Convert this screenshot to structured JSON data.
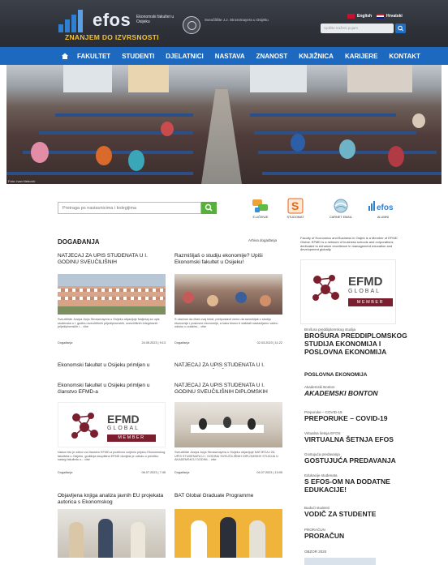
{
  "header": {
    "logo_word": "efos",
    "logo_sub": "Ekonomski fakultet u Osijeku",
    "logo_tagline": "ZNANJEM DO IZVRSNOSTI",
    "university": "Sveučilište J.J. Strossmayera u Osijeku",
    "lang_en": "English",
    "lang_hr": "Hrvatski",
    "search_placeholder": "Upišite traženi pojam",
    "brand_color": "#1d69bf"
  },
  "nav": [
    "FAKULTET",
    "STUDENTI",
    "DJELATNICI",
    "NASTAVA",
    "ZNANOST",
    "KNJIŽNICA",
    "KARIJERE",
    "KONTAKT"
  ],
  "hero": {
    "caption": "Foto: Ivan Nebović"
  },
  "search": {
    "placeholder": "Pretraga po nastavnicima i kolegijima"
  },
  "quick_links": [
    {
      "label": "E-UČENJE",
      "icon": "chat-bubbles-icon"
    },
    {
      "label": "STUDOMAT",
      "icon": "studomat-icon"
    },
    {
      "label": "CARNET EMAIL",
      "icon": "globe-mail-icon"
    },
    {
      "label": "ALUMNI",
      "icon": "efos-alumni-icon"
    }
  ],
  "events": {
    "title": "DOGAĐANJA",
    "archive": "Arhiva događanja",
    "items": [
      {
        "title": "NATJEČAJ ZA UPIS STUDENATA U I. GODINU SVEUČILIŠNIH",
        "text": "Sveučilište Josipa Jurja Strossmayera u Osijeku objavljuje Natječaj za upis studenata u I. godinu sveučilišnih prijediplomskih, sveučilišnih integriranih prijediplomskih i... više",
        "category": "Događanja",
        "date": "24.05.2023 | 9:13"
      },
      {
        "title": "Razmišljaš o studiju ekonomije? Upiši Ekonomski fakultet u Osijeku!",
        "text": "S obzirom da čitaš ovaj tekst, pretpostavit ćemo da razmišljaš o studiju ekonomije i poslovne ekonomije, a kako bismo ti olakšali nastavljamo važnu odluku o odabiru... više",
        "category": "Događanja",
        "date": "02.03.2023 | 11:22"
      },
      {
        "title": "Ekonomski fakultet u Osijeku primljen u članstvo EFMD-a",
        "text": "",
        "category": "",
        "date": ""
      },
      {
        "title": "NATJEČAJ ZA UPIS STUDENATA U I. GODINU SVEUČILIŠNIH",
        "text": "",
        "category": "",
        "date": ""
      },
      {
        "title": "Ekonomski fakultet u Osijeku primljen u članstvo EFMD-a",
        "text": "Nakon što je odbor za članstvo EFMD-a pozitivno ocijenio prijavu Ekonomskog fakulteta u Osijeku, godišnja skupština EFMD donijela je odluku o primitku našeg fakulteta u... više",
        "category": "Događanja",
        "date": "06.07.2023 | 7:45"
      },
      {
        "title": "NATJEČAJ ZA UPIS STUDENATA U I. GODINU SVEUČILIŠNIH DIPLOMSKIH",
        "text": "Sveučilište Josipa Jurja Strossmayera u Osijeku objavljuje NATJEČAJ ZA UPIS STUDENATA U I. GODINU SVEUČILIŠNIH DIPLOMSKIH STUDIJA U AKADEMSKOJ GODINI... više",
        "category": "Događanja",
        "date": "04.07.2023 | 13:05"
      },
      {
        "title": "Objavljena knjiga analiza javnih EU projekata autorica s Ekonomskog",
        "text": "",
        "category": "",
        "date": ""
      },
      {
        "title": "BAT Global Graduate Programme",
        "text": "",
        "category": "",
        "date": ""
      }
    ]
  },
  "sidebar": {
    "intro": "Faculty of Economics and Business in Osijek is a Member of EFMD Global. EFMD is a network of business schools and corporations dedicated to enhance excellence in management education and development globally.",
    "efmd": {
      "word": "EFMD",
      "global": "GLOBAL",
      "member": "MEMBER",
      "accent": "#7b1f2e"
    },
    "items": [
      {
        "small": "Brošura preddiplomskog studija",
        "big": "BROŠURA PREDDIPLOMSKOG STUDIJA EKONOMIJA I POSLOVNA EKONOMIJA"
      },
      {
        "small": "",
        "big": "POSLOVNA EKONOMIJA"
      },
      {
        "small": "Akademski Bonton",
        "big": "AKADEMSKI BONTON"
      },
      {
        "small": "Preporuke – COVID-19",
        "big": "PREPORUKE – COVID-19"
      },
      {
        "small": "Virtualna šetnja EFOS",
        "big": "VIRTUALNA ŠETNJA EFOS"
      },
      {
        "small": "Gostujuća predavanja",
        "big": "GOSTUJUĆA PREDAVANJA"
      },
      {
        "small": "Edukacije studenata",
        "big": "S EFOS-OM NA DODATNE EDUKACIJE!"
      },
      {
        "small": "Budući studenti",
        "big": "VODIČ ZA STUDENTE"
      },
      {
        "small": "PRORAČUN",
        "big": "PRORAČUN"
      },
      {
        "small": "OBZOR 2020",
        "big": ""
      }
    ]
  }
}
